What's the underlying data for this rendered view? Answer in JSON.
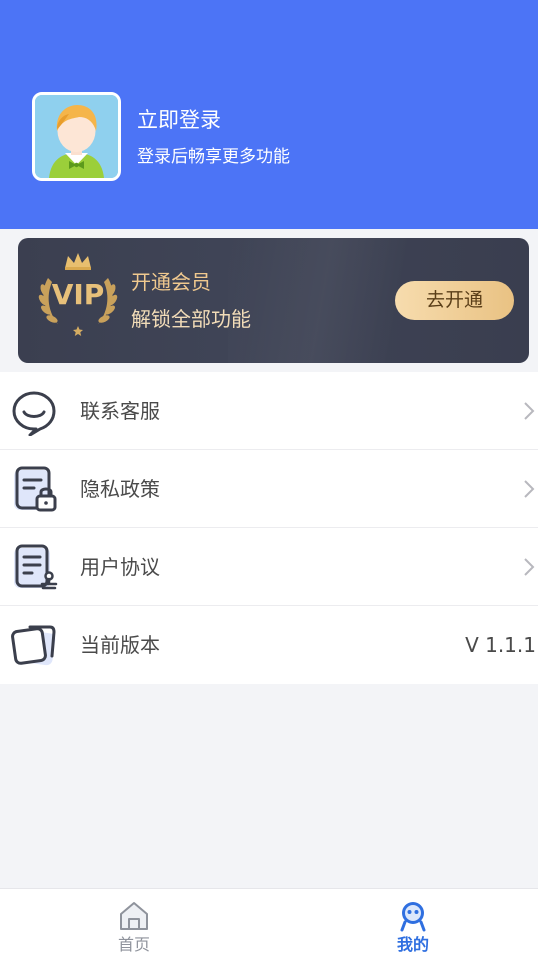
{
  "header": {
    "login_title": "立即登录",
    "login_subtitle": "登录后畅享更多功能",
    "background_color": "#4c74f6"
  },
  "vip": {
    "badge_text": "VIP",
    "title": "开通会员",
    "subtitle": "解锁全部功能",
    "button_label": "去开通"
  },
  "menu": {
    "items": [
      {
        "label": "联系客服",
        "icon": "customer-service-icon",
        "has_arrow": true
      },
      {
        "label": "隐私政策",
        "icon": "privacy-lock-document-icon",
        "has_arrow": true
      },
      {
        "label": "用户协议",
        "icon": "user-agreement-document-icon",
        "has_arrow": true
      },
      {
        "label": "当前版本",
        "icon": "version-cards-icon",
        "value": "V 1.1.1"
      }
    ]
  },
  "tabbar": {
    "tabs": [
      {
        "label": "首页",
        "icon": "home-icon",
        "active": false,
        "color": "#8f939c"
      },
      {
        "label": "我的",
        "icon": "profile-robot-icon",
        "active": true,
        "color": "#2f6fe0"
      }
    ]
  }
}
